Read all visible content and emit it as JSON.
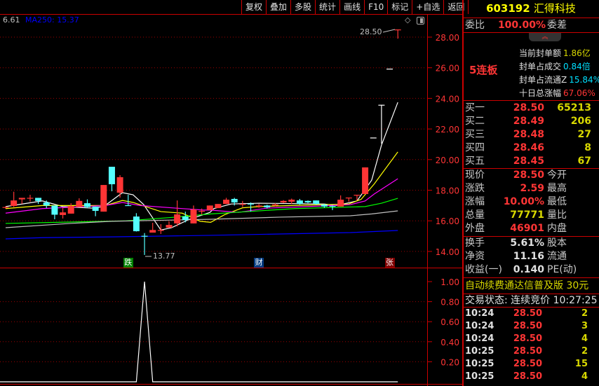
{
  "toolbar": {
    "items": [
      "复权",
      "叠加",
      "多股",
      "统计",
      "画线",
      "F10",
      "标记",
      "+自选",
      "返回"
    ]
  },
  "chart_header": {
    "indicator_value": "6.61",
    "ma250_label": "MA250: 15.37",
    "ma250_color": "#0000ff"
  },
  "annotations": {
    "high_label": "28.50",
    "low_label": "13.77",
    "markers": [
      {
        "text": "跌",
        "bg": "#008000",
        "index": 15
      },
      {
        "text": "财",
        "bg": "#003a80",
        "index": 31
      },
      {
        "text": "张",
        "bg": "#800000",
        "index": 47
      }
    ]
  },
  "colors": {
    "up": "#ff3535",
    "down": "#54ffff",
    "limit": "#ffffff",
    "grid": "#a00000",
    "axis_text": "#ff3535"
  },
  "chart_data": [
    {
      "type": "candlestick",
      "price_axis": {
        "ticks": [
          "28.00",
          "26.00",
          "24.00",
          "22.00",
          "20.00",
          "18.00",
          "16.00",
          "14.00"
        ],
        "range": [
          13.5,
          28.5
        ]
      },
      "candles": [
        [
          16.85,
          16.95,
          16.8,
          16.9
        ],
        [
          16.97,
          17.9,
          16.9,
          17.33
        ],
        [
          17.4,
          17.5,
          17.1,
          17.5
        ],
        [
          17.48,
          17.7,
          17.25,
          17.5
        ],
        [
          17.5,
          17.5,
          17.1,
          17.3
        ],
        [
          17.2,
          17.33,
          16.83,
          17.0
        ],
        [
          17.0,
          17.0,
          16.1,
          16.4
        ],
        [
          16.38,
          16.83,
          16.15,
          16.55
        ],
        [
          16.47,
          17.15,
          16.47,
          16.97
        ],
        [
          16.9,
          17.47,
          16.9,
          17.3
        ],
        [
          17.15,
          17.4,
          16.83,
          16.9
        ],
        [
          16.93,
          16.93,
          16.3,
          16.65
        ],
        [
          16.6,
          18.34,
          16.6,
          18.34
        ],
        [
          19.53,
          19.53,
          17.93,
          18.39
        ],
        [
          17.84,
          18.98,
          17.52,
          18.85
        ],
        [
          17.02,
          17.7,
          17.0,
          17.0
        ],
        [
          16.28,
          16.5,
          15.3,
          15.32
        ],
        [
          15.02,
          15.2,
          13.77,
          15.0
        ],
        [
          15.23,
          15.87,
          15.23,
          15.4
        ],
        [
          15.38,
          15.78,
          15.14,
          15.4
        ],
        [
          15.55,
          15.96,
          15.55,
          15.73
        ],
        [
          15.83,
          17.33,
          15.64,
          16.42
        ],
        [
          16.28,
          16.6,
          15.9,
          16.05
        ],
        [
          15.83,
          17.0,
          15.83,
          16.74
        ],
        [
          16.63,
          16.8,
          16.4,
          16.65
        ],
        [
          16.7,
          17.0,
          16.7,
          17.0
        ],
        [
          16.83,
          17.1,
          16.83,
          17.1
        ],
        [
          17.1,
          17.5,
          17.1,
          17.38
        ],
        [
          17.43,
          17.5,
          17.0,
          17.2
        ],
        [
          17.08,
          17.3,
          16.9,
          17.1
        ],
        [
          17.12,
          17.2,
          16.6,
          17.1
        ],
        [
          16.93,
          17.1,
          16.85,
          17.0
        ],
        [
          17.0,
          17.05,
          16.8,
          16.88
        ],
        [
          17.0,
          17.15,
          16.95,
          17.07
        ],
        [
          17.2,
          17.35,
          17.15,
          17.3
        ],
        [
          17.25,
          17.45,
          17.1,
          17.38
        ],
        [
          17.33,
          17.43,
          17.05,
          17.1
        ],
        [
          17.3,
          17.33,
          17.15,
          17.2
        ],
        [
          17.33,
          17.33,
          17.05,
          17.1
        ],
        [
          17.05,
          17.1,
          16.85,
          16.93
        ],
        [
          16.97,
          17.0,
          16.7,
          16.95
        ],
        [
          16.93,
          17.66,
          16.93,
          17.38
        ],
        [
          17.48,
          17.52,
          17.25,
          17.52
        ],
        [
          17.66,
          17.7,
          17.33,
          17.7
        ],
        [
          17.75,
          19.49,
          17.75,
          19.49
        ],
        [
          21.44,
          21.44,
          21.44,
          21.44
        ],
        [
          23.58,
          23.58,
          21.04,
          23.58
        ],
        [
          25.94,
          25.94,
          25.94,
          25.94
        ],
        [
          28.5,
          28.5,
          27.9,
          28.5
        ]
      ],
      "limit_board_indices": [
        45,
        46,
        47
      ],
      "moving_averages": [
        {
          "color": "#ffffff",
          "points": [
            [
              0,
              16.93
            ],
            [
              4.5,
              17.3
            ],
            [
              7,
              16.93
            ],
            [
              10.5,
              16.83
            ],
            [
              12,
              16.93
            ],
            [
              14.3,
              17.84
            ],
            [
              15.6,
              17.7
            ],
            [
              16.9,
              17.06
            ],
            [
              19,
              15.4
            ],
            [
              20.3,
              15.55
            ],
            [
              22.5,
              16.1
            ],
            [
              25,
              16.55
            ],
            [
              25.5,
              16.8
            ],
            [
              27.6,
              17.1
            ],
            [
              31,
              17.15
            ],
            [
              39,
              17.1
            ],
            [
              40.5,
              17.0
            ],
            [
              43,
              17.3
            ],
            [
              44.8,
              18.66
            ],
            [
              46,
              20.95
            ],
            [
              48,
              23.74
            ]
          ]
        },
        {
          "color": "#ffff00",
          "points": [
            [
              0,
              16.8
            ],
            [
              4.5,
              17.0
            ],
            [
              12.2,
              17.0
            ],
            [
              14.3,
              17.33
            ],
            [
              15.6,
              17.2
            ],
            [
              19,
              16.6
            ],
            [
              21.6,
              16.5
            ],
            [
              23.8,
              15.97
            ],
            [
              25.1,
              15.9
            ],
            [
              26.8,
              16.4
            ],
            [
              29,
              16.85
            ],
            [
              31,
              16.93
            ],
            [
              35,
              17.0
            ],
            [
              42,
              17.1
            ],
            [
              43.5,
              17.4
            ],
            [
              45.1,
              18.4
            ],
            [
              48,
              20.5
            ]
          ]
        },
        {
          "color": "#ff00ff",
          "points": [
            [
              0,
              16.5
            ],
            [
              4.5,
              16.8
            ],
            [
              12.2,
              17.0
            ],
            [
              14.3,
              17.2
            ],
            [
              16.5,
              17.0
            ],
            [
              20.8,
              16.83
            ],
            [
              24.2,
              16.7
            ],
            [
              25.1,
              16.7
            ],
            [
              28.5,
              16.55
            ],
            [
              32,
              16.83
            ],
            [
              37,
              16.93
            ],
            [
              42.2,
              17.06
            ],
            [
              44,
              17.3
            ],
            [
              45.1,
              17.75
            ],
            [
              48,
              18.75
            ]
          ]
        },
        {
          "color": "#00ff00",
          "points": [
            [
              0,
              15.83
            ],
            [
              6.2,
              15.9
            ],
            [
              14.8,
              16.0
            ],
            [
              20.8,
              16.24
            ],
            [
              25.1,
              16.45
            ],
            [
              35.4,
              16.8
            ],
            [
              44,
              16.93
            ],
            [
              46,
              17.15
            ],
            [
              48,
              17.47
            ]
          ]
        },
        {
          "color": "#c0c0c0",
          "points": [
            [
              0,
              15.55
            ],
            [
              7.9,
              15.83
            ],
            [
              13,
              15.97
            ],
            [
              25.1,
              16.1
            ],
            [
              33.6,
              16.24
            ],
            [
              42.2,
              16.33
            ],
            [
              44.8,
              16.45
            ],
            [
              48,
              16.65
            ]
          ]
        },
        {
          "name": "MA250",
          "color": "#0000ff",
          "points": [
            [
              0,
              14.82
            ],
            [
              4.5,
              14.9
            ],
            [
              13,
              14.95
            ],
            [
              25.1,
              15.05
            ],
            [
              33.6,
              15.14
            ],
            [
              42.2,
              15.23
            ],
            [
              48,
              15.37
            ]
          ]
        }
      ]
    },
    {
      "type": "line",
      "axis": {
        "ticks": [
          "1.00",
          "0.80",
          "0.60",
          "0.40",
          "0.20"
        ],
        "range": [
          0,
          1
        ]
      },
      "values": [
        0,
        0,
        0,
        0,
        0,
        0,
        0,
        0,
        0,
        0,
        0,
        0,
        0,
        0,
        0,
        0,
        0,
        1,
        0,
        0,
        0,
        0,
        0,
        0,
        0,
        0,
        0,
        0,
        0,
        0,
        0,
        0,
        0,
        0,
        0,
        0,
        0,
        0,
        0,
        0,
        0,
        0,
        0,
        0,
        0,
        0,
        0,
        0,
        0
      ]
    }
  ],
  "quote": {
    "code": "603192",
    "name": "汇得科技",
    "weibi_label": "委比",
    "weibi_value": "100.00%",
    "weicha_label": "委差",
    "board": "5连板",
    "seal": [
      {
        "label": "当前封单额",
        "value": "1.86亿",
        "color": "yel"
      },
      {
        "label": "封单占成交",
        "value": "0.84倍",
        "color": "cyan"
      },
      {
        "label": "封单占流通Z",
        "value": "15.84%",
        "color": "cyan"
      },
      {
        "label": "十日总涨幅",
        "value": "67.06%",
        "color": "red"
      }
    ],
    "bids": [
      {
        "label": "买一",
        "price": "28.50",
        "vol": "65213"
      },
      {
        "label": "买二",
        "price": "28.49",
        "vol": "206"
      },
      {
        "label": "买三",
        "price": "28.48",
        "vol": "27"
      },
      {
        "label": "买四",
        "price": "28.46",
        "vol": "8"
      },
      {
        "label": "买五",
        "price": "28.45",
        "vol": "67"
      }
    ],
    "stats": [
      {
        "label": "现价",
        "value": "28.50",
        "color": "red",
        "label2": "今开"
      },
      {
        "label": "涨跌",
        "value": "2.59",
        "color": "red",
        "label2": "最高"
      },
      {
        "label": "涨幅",
        "value": "10.00%",
        "color": "red",
        "label2": "最低"
      },
      {
        "label": "总量",
        "value": "77771",
        "color": "yel",
        "label2": "量比"
      },
      {
        "label": "外盘",
        "value": "46901",
        "color": "red",
        "label2": "内盘"
      }
    ],
    "stats2": [
      {
        "label": "换手",
        "value": "5.61%",
        "label2": "股本"
      },
      {
        "label": "净资",
        "value": "11.16",
        "label2": "流通"
      },
      {
        "label": "收益(一)",
        "value": "0.140",
        "label2": "PE(动)"
      }
    ],
    "ad": "自动续费通达信普及版  30元",
    "status": "交易状态: 连续竞价  10:27:25",
    "ticks": [
      {
        "time": "10:24",
        "price": "28.50",
        "vol": "2"
      },
      {
        "time": "10:24",
        "price": "28.50",
        "vol": "3"
      },
      {
        "time": "10:24",
        "price": "28.50",
        "vol": "4"
      },
      {
        "time": "10:25",
        "price": "28.50",
        "vol": "2"
      },
      {
        "time": "10:25",
        "price": "28.50",
        "vol": "15"
      },
      {
        "time": "10:25",
        "price": "28.50",
        "vol": "4"
      }
    ]
  }
}
